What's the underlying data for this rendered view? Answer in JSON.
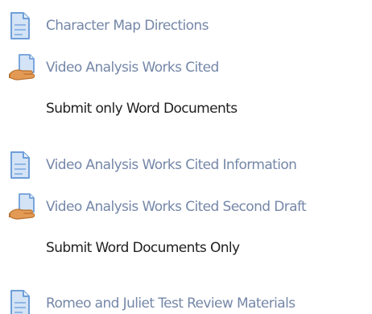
{
  "items": [
    {
      "type": "resource",
      "icon": "document-icon",
      "label": "Character Map Directions"
    },
    {
      "type": "assignment",
      "icon": "assignment-hand-icon",
      "label": "Video Analysis Works Cited",
      "note": "Submit only Word Documents"
    },
    {
      "type": "resource",
      "icon": "document-icon",
      "label": "Video Analysis Works Cited Information"
    },
    {
      "type": "assignment",
      "icon": "assignment-hand-icon",
      "label": "Video Analysis Works Cited Second Draft",
      "note": "Submit Word Documents Only"
    },
    {
      "type": "resource",
      "icon": "document-icon",
      "label": "Romeo and Juliet Test Review Materials"
    }
  ],
  "colors": {
    "link": "#7587a8",
    "note": "#1f1f1f",
    "doc_icon_fill": "#d4e3f6",
    "doc_icon_stroke": "#6f9fd8",
    "hand_icon": "#d9904a"
  }
}
